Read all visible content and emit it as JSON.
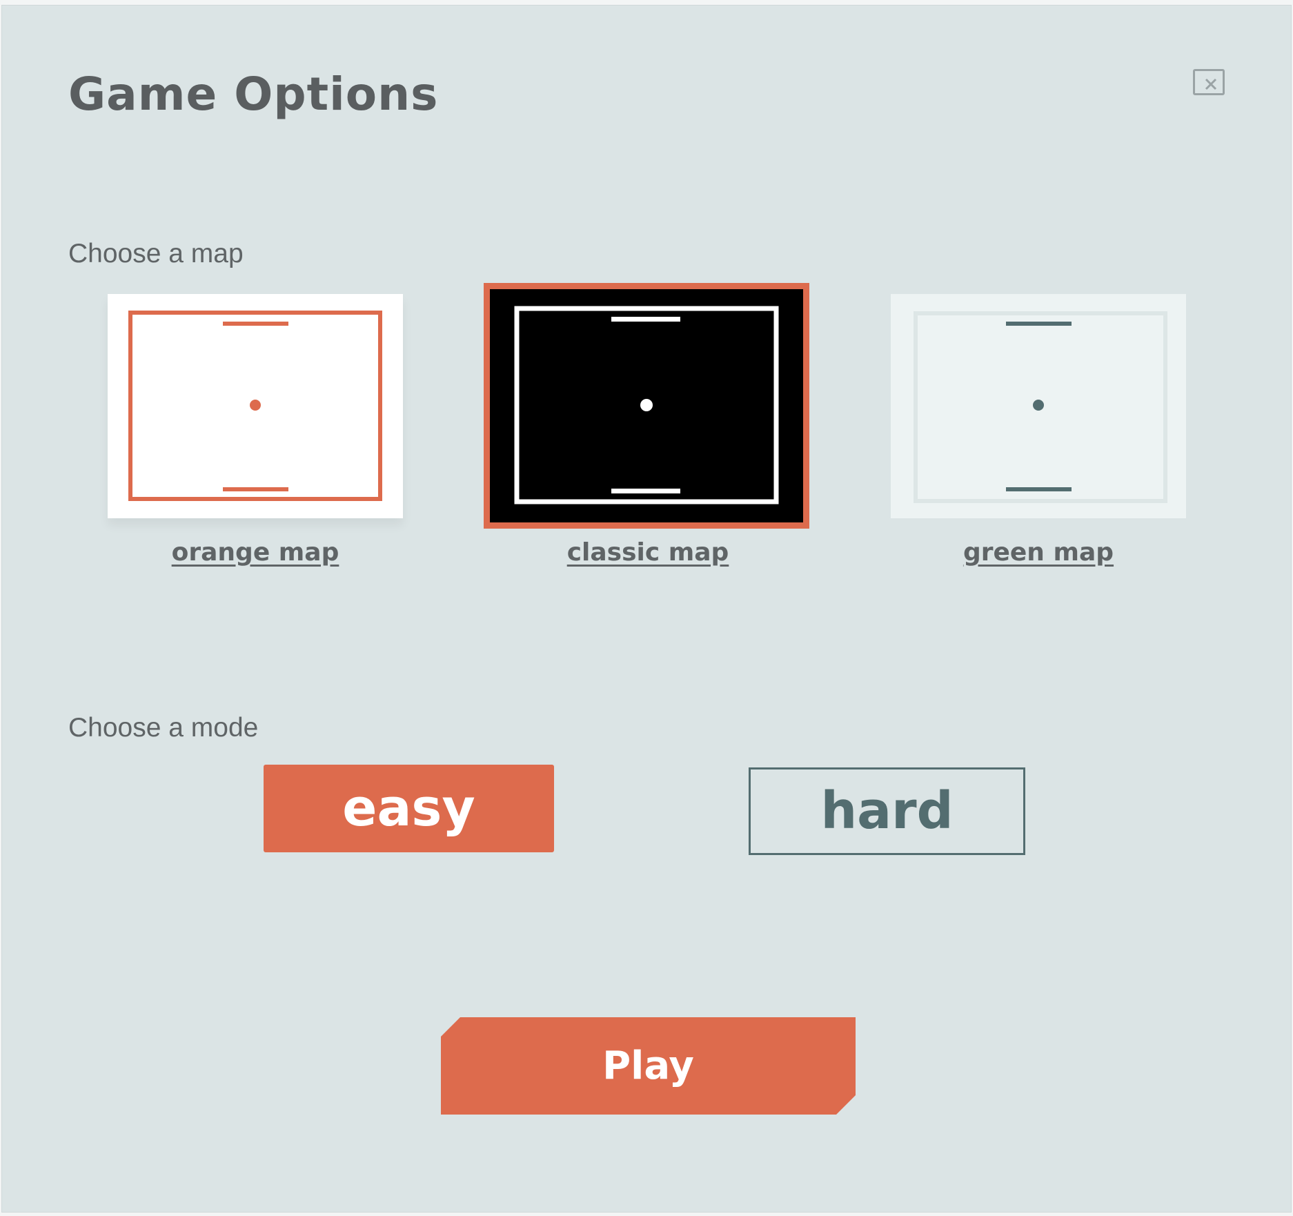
{
  "dialog": {
    "title": "Game Options",
    "close_icon": "close-icon"
  },
  "map_section": {
    "label": "Choose a map",
    "selected": "classic",
    "maps": [
      {
        "id": "orange",
        "name": "orange map",
        "background": "#ffffff",
        "accent": "#dd6b4d"
      },
      {
        "id": "classic",
        "name": "classic map",
        "background": "#000000",
        "accent": "#ffffff"
      },
      {
        "id": "green",
        "name": "green map",
        "background": "#edf3f3",
        "accent": "#536d70"
      }
    ]
  },
  "mode_section": {
    "label": "Choose a mode",
    "selected": "easy",
    "modes": [
      {
        "id": "easy",
        "label": "easy"
      },
      {
        "id": "hard",
        "label": "hard"
      }
    ]
  },
  "play": {
    "label": "Play"
  },
  "colors": {
    "accent": "#dd6b4d",
    "panel": "#dbe4e5",
    "text": "#5a5e60",
    "slate": "#536d70"
  }
}
